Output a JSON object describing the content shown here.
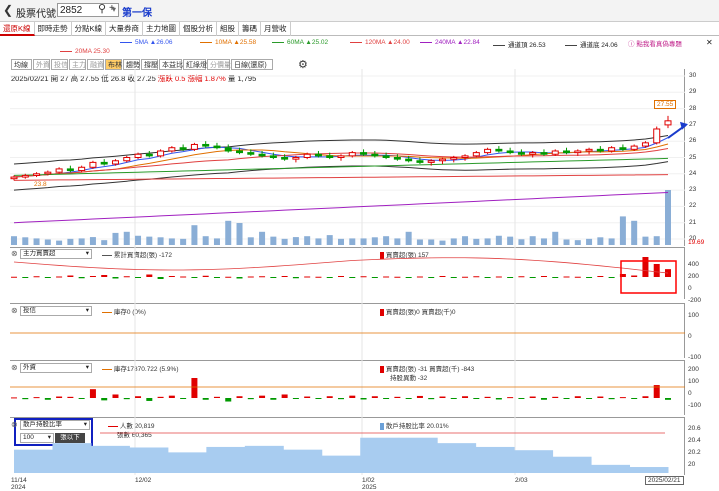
{
  "toolbar": {
    "back_icon": "chevron-left-icon",
    "stock_code_label": "股票代號",
    "stock_code_value": "2852",
    "stock_name": "第一保"
  },
  "tabs": [
    "還原K線",
    "即時走勢",
    "分點K線",
    "大量券商",
    "主力地圖",
    "個股分析",
    "組股",
    "籌碼",
    "月營收"
  ],
  "active_tab": 0,
  "legend_top": {
    "ma20": "20MA 25.30",
    "ma5": "5MA ▲26.06",
    "ma10": "10MA ▲25.58",
    "ma60": "60MA ▲25.02",
    "ma120": "120MA ▲24.00",
    "ma240": "240MA ▲22.84",
    "upper": "通道頂 26.53",
    "lower": "通道底 24.06",
    "promo": "點我看真偽專題"
  },
  "tools": [
    "均線",
    "外資",
    "投信",
    "主力",
    "融資",
    "布林",
    "趨勢",
    "撐壓",
    "本益比",
    "紅綠燈",
    "分價量",
    "日線(還原)"
  ],
  "selected_tool": "布林",
  "dim_tools": [
    "外資",
    "投信",
    "主力",
    "融資",
    "分價量"
  ],
  "quote": {
    "date": "2025/02/21",
    "open": "開 27",
    "high": "高 27.55",
    "low": "低 26.8",
    "close": "收 27.25",
    "change": "漲跌 0.5",
    "pct": "漲幅 1.87%",
    "volume": "量 1,795"
  },
  "price_axis": [
    "30",
    "29",
    "28",
    "27",
    "26",
    "25",
    "24",
    "23",
    "22",
    "21",
    "20"
  ],
  "price_marks": {
    "last": "27.55",
    "low": "19.69",
    "ma_label": "23.8"
  },
  "panels": {
    "main_force": {
      "select": "主力買賣超",
      "cum": "累計買賣超(張) -172",
      "today": "買賣超(張) 157",
      "axis": [
        "400",
        "200",
        "0",
        "-200"
      ]
    },
    "trust": {
      "select": "投信",
      "hold": "庫存0 (0%)",
      "today": "買賣超(張)0 買賣超(千)0",
      "axis": [
        "100",
        "0",
        "-100"
      ]
    },
    "foreign": {
      "select": "外資",
      "hold": "庫存17870.722 (5.9%)",
      "today": "買賣超(張) -31 買賣超(千) -843",
      "change": "持股異動 -32",
      "axis": [
        "200",
        "100",
        "0",
        "-100"
      ]
    },
    "holders": {
      "select": "散戶持股比率",
      "threshold": "100",
      "threshold_label": "張以下",
      "people": "人數 20,819",
      "shares": "張數 60,365",
      "ratio": "散戶持股比率 20.01%",
      "axis": [
        "20.6",
        "20.4",
        "20.2",
        "20"
      ]
    }
  },
  "date_axis": [
    {
      "label": "11/14",
      "sub": "2024"
    },
    {
      "label": "12/02",
      "sub": ""
    },
    {
      "label": "1/02",
      "sub": "2025"
    },
    {
      "label": "2/03",
      "sub": ""
    }
  ],
  "current_date": "2025/02/21",
  "colors": {
    "up": "#e00000",
    "down": "#009900",
    "accent": "#1a3ccc",
    "vol": "#8aaed6",
    "highlight": "#ff0000"
  },
  "chart_data": {
    "type": "candlestick",
    "candles": [
      [
        23.7,
        23.9,
        23.6,
        23.8
      ],
      [
        23.8,
        24.0,
        23.7,
        23.9
      ],
      [
        23.9,
        24.1,
        23.8,
        24.0
      ],
      [
        24.0,
        24.2,
        23.9,
        24.1
      ],
      [
        24.1,
        24.4,
        24.0,
        24.3
      ],
      [
        24.3,
        24.5,
        24.1,
        24.2
      ],
      [
        24.2,
        24.5,
        24.1,
        24.4
      ],
      [
        24.4,
        24.8,
        24.3,
        24.7
      ],
      [
        24.7,
        24.9,
        24.5,
        24.6
      ],
      [
        24.6,
        24.9,
        24.5,
        24.8
      ],
      [
        24.8,
        25.1,
        24.7,
        25.0
      ],
      [
        25.0,
        25.3,
        24.9,
        25.2
      ],
      [
        25.2,
        25.4,
        25.0,
        25.1
      ],
      [
        25.1,
        25.5,
        25.0,
        25.4
      ],
      [
        25.4,
        25.7,
        25.3,
        25.6
      ],
      [
        25.6,
        25.8,
        25.4,
        25.5
      ],
      [
        25.5,
        25.9,
        25.4,
        25.8
      ],
      [
        25.8,
        26.0,
        25.6,
        25.7
      ],
      [
        25.7,
        25.9,
        25.5,
        25.6
      ],
      [
        25.6,
        25.8,
        25.3,
        25.4
      ],
      [
        25.4,
        25.6,
        25.2,
        25.3
      ],
      [
        25.3,
        25.5,
        25.1,
        25.2
      ],
      [
        25.2,
        25.4,
        25.0,
        25.1
      ],
      [
        25.1,
        25.3,
        24.9,
        25.0
      ],
      [
        25.0,
        25.2,
        24.8,
        24.9
      ],
      [
        24.9,
        25.1,
        24.7,
        25.0
      ],
      [
        25.0,
        25.3,
        24.9,
        25.2
      ],
      [
        25.2,
        25.4,
        25.0,
        25.1
      ],
      [
        25.1,
        25.3,
        24.9,
        25.0
      ],
      [
        25.0,
        25.2,
        24.8,
        25.1
      ],
      [
        25.1,
        25.4,
        25.0,
        25.3
      ],
      [
        25.3,
        25.5,
        25.1,
        25.2
      ],
      [
        25.2,
        25.4,
        25.0,
        25.1
      ],
      [
        25.1,
        25.3,
        24.9,
        25.0
      ],
      [
        25.0,
        25.2,
        24.8,
        24.9
      ],
      [
        24.9,
        25.1,
        24.7,
        24.8
      ],
      [
        24.8,
        25.0,
        24.6,
        24.7
      ],
      [
        24.7,
        24.9,
        24.5,
        24.8
      ],
      [
        24.8,
        25.0,
        24.6,
        24.9
      ],
      [
        24.9,
        25.1,
        24.7,
        25.0
      ],
      [
        25.0,
        25.2,
        24.8,
        25.1
      ],
      [
        25.1,
        25.4,
        25.0,
        25.3
      ],
      [
        25.3,
        25.6,
        25.2,
        25.5
      ],
      [
        25.5,
        25.7,
        25.3,
        25.4
      ],
      [
        25.4,
        25.6,
        25.2,
        25.3
      ],
      [
        25.3,
        25.5,
        25.1,
        25.2
      ],
      [
        25.2,
        25.4,
        25.0,
        25.3
      ],
      [
        25.3,
        25.5,
        25.1,
        25.2
      ],
      [
        25.2,
        25.5,
        25.1,
        25.4
      ],
      [
        25.4,
        25.6,
        25.2,
        25.3
      ],
      [
        25.3,
        25.5,
        25.1,
        25.4
      ],
      [
        25.4,
        25.6,
        25.2,
        25.5
      ],
      [
        25.5,
        25.7,
        25.3,
        25.4
      ],
      [
        25.4,
        25.7,
        25.3,
        25.6
      ],
      [
        25.6,
        25.8,
        25.4,
        25.5
      ],
      [
        25.5,
        25.8,
        25.4,
        25.7
      ],
      [
        25.7,
        26.0,
        25.6,
        25.9
      ],
      [
        25.9,
        26.9,
        25.8,
        26.75
      ],
      [
        27.0,
        27.55,
        26.8,
        27.25
      ]
    ],
    "volumes": [
      40,
      35,
      30,
      25,
      20,
      28,
      30,
      36,
      22,
      55,
      60,
      42,
      38,
      35,
      30,
      28,
      90,
      40,
      30,
      110,
      100,
      35,
      60,
      38,
      28,
      36,
      40,
      30,
      45,
      28,
      30,
      30,
      35,
      40,
      30,
      60,
      25,
      25,
      20,
      30,
      40,
      28,
      30,
      42,
      38,
      26,
      40,
      30,
      60,
      25,
      22,
      28,
      35,
      30,
      130,
      110,
      38,
      40,
      250
    ],
    "main_force": [
      5,
      -10,
      15,
      -20,
      10,
      30,
      -25,
      20,
      40,
      -30,
      15,
      -10,
      50,
      -40,
      20,
      10,
      -15,
      25,
      -20,
      5,
      -30,
      10,
      15,
      -10,
      20,
      -25,
      10,
      5,
      -15,
      20,
      -10,
      15,
      -20,
      10,
      5,
      -5,
      10,
      -15,
      20,
      -10,
      5,
      15,
      -20,
      10,
      -5,
      15,
      -10,
      20,
      -15,
      10,
      5,
      -10,
      20,
      -5,
      60,
      30,
      400,
      260,
      157
    ],
    "foreign": [
      10,
      -20,
      15,
      -30,
      25,
      20,
      -15,
      150,
      -40,
      60,
      -20,
      30,
      -50,
      20,
      40,
      -10,
      340,
      -30,
      20,
      -60,
      30,
      -20,
      40,
      -30,
      60,
      -10,
      25,
      -15,
      30,
      -20,
      40,
      -25,
      30,
      -15,
      20,
      -10,
      35,
      -20,
      25,
      -15,
      30,
      -10,
      20,
      -25,
      15,
      -10,
      25,
      -30,
      20,
      -15,
      30,
      -10,
      25,
      -20,
      15,
      -10,
      30,
      220,
      -31
    ],
    "holders": [
      20.33,
      20.45,
      20.4,
      20.37,
      20.28,
      20.38,
      20.4,
      20.33,
      20.22,
      20.55,
      20.55,
      20.45,
      20.38,
      20.32,
      20.2,
      20.05,
      20.01
    ],
    "ylim": [
      19.69,
      30
    ]
  }
}
